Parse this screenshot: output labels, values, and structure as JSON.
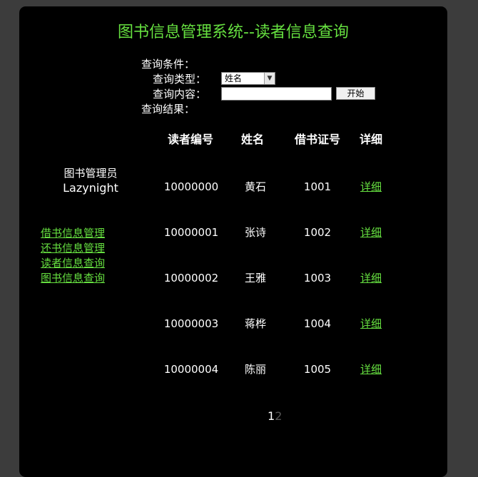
{
  "title": "图书信息管理系统--读者信息查询",
  "query": {
    "conditions_label": "查询条件：",
    "type_label": "查询类型：",
    "type_selected": "姓名",
    "content_label": "查询内容：",
    "content_value": "",
    "start_button": "开始",
    "results_label": "查询结果："
  },
  "sidebar": {
    "role": "图书管理员",
    "username": "Lazynight",
    "links": [
      "借书信息管理",
      "还书信息管理",
      "读者信息查询",
      "图书信息查询"
    ]
  },
  "table": {
    "headers": [
      "读者编号",
      "姓名",
      "借书证号",
      "详细"
    ],
    "rows": [
      {
        "id": "10000000",
        "name": "黄石",
        "card": "1001",
        "detail": "详细"
      },
      {
        "id": "10000001",
        "name": "张诗",
        "card": "1002",
        "detail": "详细"
      },
      {
        "id": "10000002",
        "name": "王雅",
        "card": "1003",
        "detail": "详细"
      },
      {
        "id": "10000003",
        "name": "蒋桦",
        "card": "1004",
        "detail": "详细"
      },
      {
        "id": "10000004",
        "name": "陈丽",
        "card": "1005",
        "detail": "详细"
      }
    ]
  },
  "pagination": {
    "current": "1",
    "next": "2"
  },
  "colors": {
    "accent": "#66e040",
    "panel": "#000000",
    "page_bg": "#3c3c3c"
  }
}
